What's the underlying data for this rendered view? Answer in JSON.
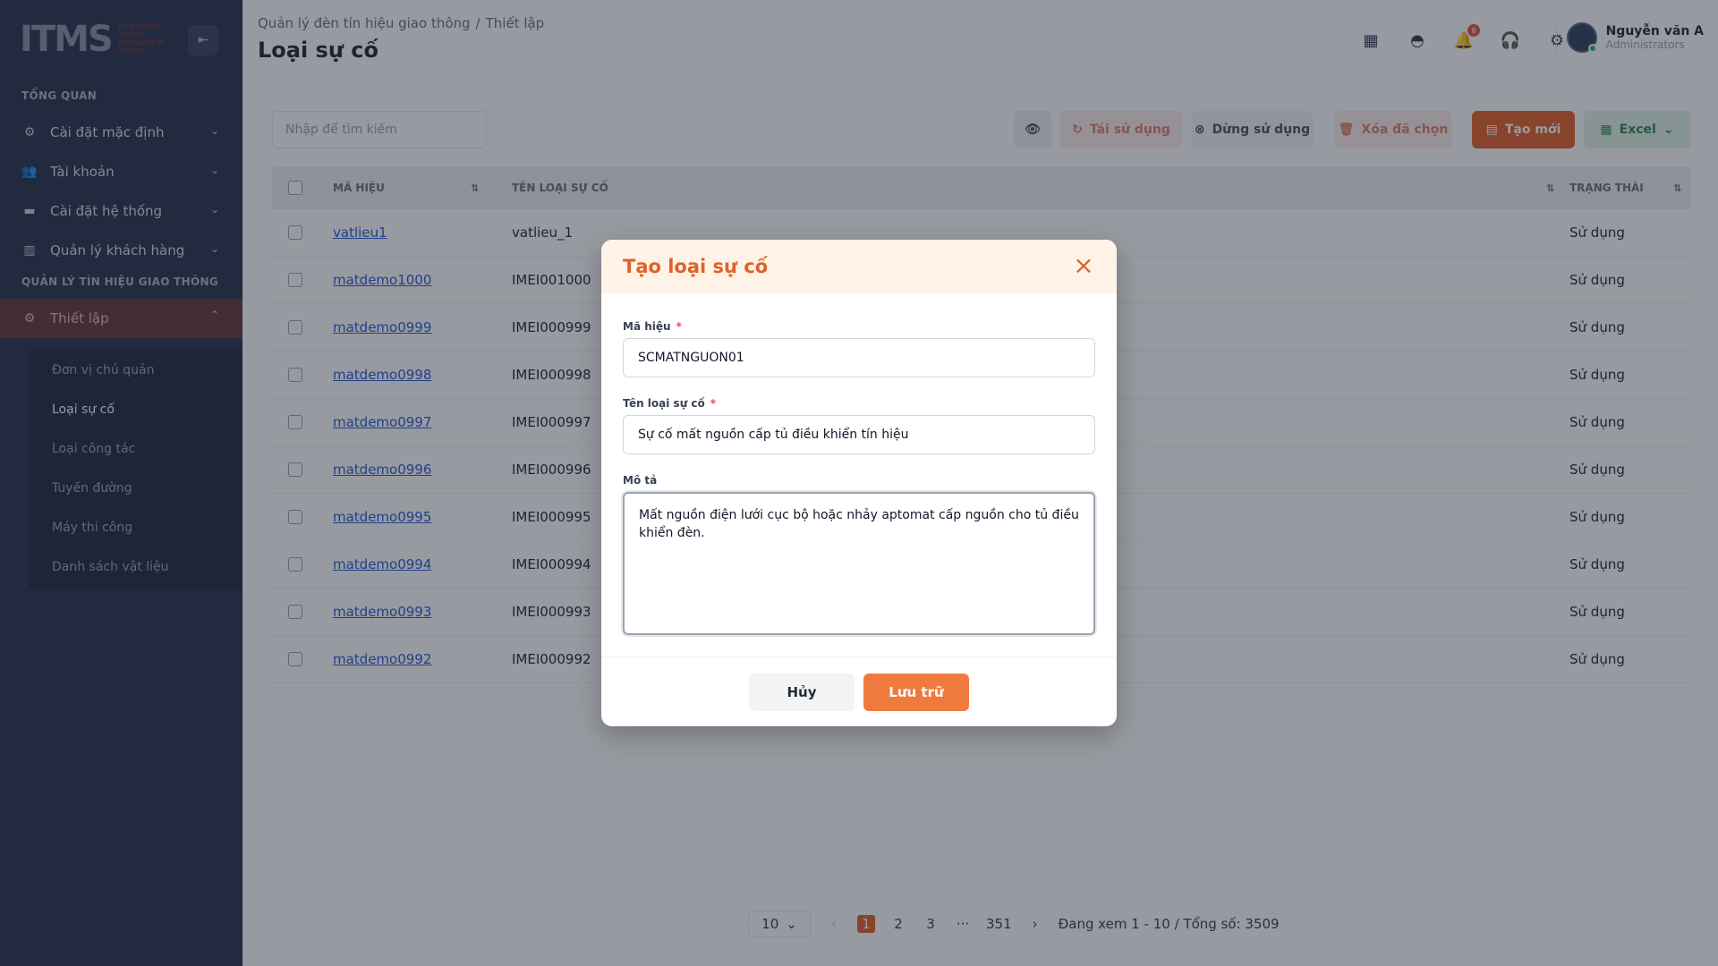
{
  "sidebar": {
    "logo_text": "ITMS",
    "logo_sub": "INTELLIGENT TRAFFIC MANAGEMENT SYSTEM",
    "section_overview": "TỔNG QUAN",
    "section_traffic": "QUẢN LÝ TÍN HIỆU GIAO THÔNG",
    "items": [
      {
        "label": "Cài đặt mặc định",
        "icon": "gear-icon"
      },
      {
        "label": "Tài khoản",
        "icon": "users-icon"
      },
      {
        "label": "Cài đặt hệ thống",
        "icon": "window-icon"
      },
      {
        "label": "Quản lý khách hàng",
        "icon": "building-icon"
      },
      {
        "label": "Thiết lập",
        "icon": "gear-icon"
      }
    ],
    "sub_items": [
      "Đơn vị chủ quản",
      "Loại sự cố",
      "Loại công tác",
      "Tuyến đường",
      "Máy thi công",
      "Danh sách vật liệu"
    ]
  },
  "header": {
    "breadcrumb": [
      "Quản lý đèn tín hiệu giao thông",
      "Thiết lập"
    ],
    "breadcrumb_sep": "/",
    "title": "Loại sự cố",
    "notification_count": "8",
    "user_name": "Nguyễn văn A",
    "user_role": "Administrators"
  },
  "toolbar": {
    "search_placeholder": "Nhập để tìm kiếm",
    "reuse": "Tái sử dụng",
    "stop": "Dừng sử dụng",
    "delete_selected": "Xóa đã chọn",
    "create_new": "Tạo mới",
    "excel": "Excel"
  },
  "table": {
    "headers": {
      "code": "MÃ HIỆU",
      "name": "TÊN LOẠI SỰ CỐ",
      "status": "TRẠNG THÁI"
    },
    "rows": [
      {
        "code": "vatlieu1",
        "name": "vatlieu_1",
        "status": "Sử dụng"
      },
      {
        "code": "matdemo1000",
        "name": "IMEI001000",
        "status": "Sử dụng"
      },
      {
        "code": "matdemo0999",
        "name": "IMEI000999",
        "status": "Sử dụng"
      },
      {
        "code": "matdemo0998",
        "name": "IMEI000998",
        "status": "Sử dụng"
      },
      {
        "code": "matdemo0997",
        "name": "IMEI000997",
        "status": "Sử dụng"
      },
      {
        "code": "matdemo0996",
        "name": "IMEI000996",
        "status": "Sử dụng"
      },
      {
        "code": "matdemo0995",
        "name": "IMEI000995",
        "status": "Sử dụng"
      },
      {
        "code": "matdemo0994",
        "name": "IMEI000994",
        "status": "Sử dụng"
      },
      {
        "code": "matdemo0993",
        "name": "IMEI000993",
        "status": "Sử dụng"
      },
      {
        "code": "matdemo0992",
        "name": "IMEI000992",
        "status": "Sử dụng"
      }
    ]
  },
  "pagination": {
    "page_size": "10",
    "pages": [
      "1",
      "2",
      "3",
      "···",
      "351"
    ],
    "summary": "Đang xem 1 - 10 / Tổng số: 3509"
  },
  "modal": {
    "title": "Tạo loại sự cố",
    "code_label": "Mã hiệu",
    "code_value": "SCMATNGUON01",
    "name_label": "Tên loại sự cố",
    "name_value": "Sự cố mất nguồn cấp tủ điều khiển tín hiệu",
    "desc_label": "Mô tả",
    "desc_value": "Mất nguồn điện lưới cục bộ hoặc nhảy aptomat cấp nguồn cho tủ điều khiển đèn.",
    "required_mark": "*",
    "cancel": "Hủy",
    "save": "Lưu trữ"
  },
  "colors": {
    "accent": "#e2622b",
    "sidebar": "#2a3450",
    "link": "#2b5bd7"
  }
}
